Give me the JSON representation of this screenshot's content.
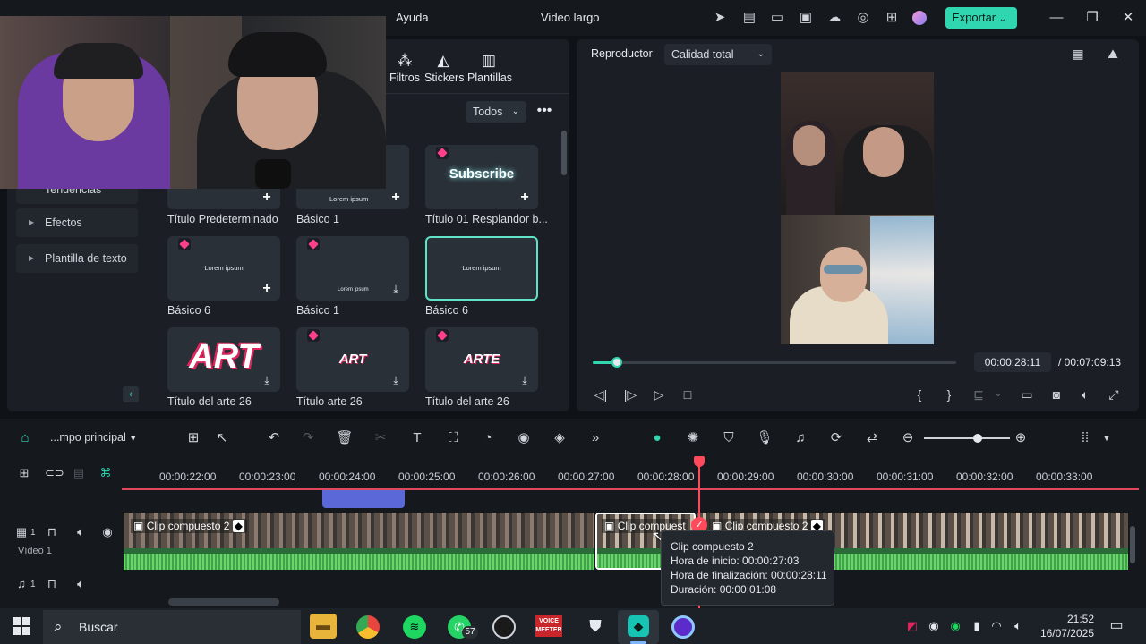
{
  "app": {
    "menu_help": "Ayuda",
    "project_title": "Video largo",
    "export_label": "Exportar",
    "accent": "#2fd6b0"
  },
  "media_tabs": [
    {
      "label": "Filtros",
      "icon": "filters-icon"
    },
    {
      "label": "Stickers",
      "icon": "stickers-icon"
    },
    {
      "label": "Plantillas",
      "icon": "templates-icon"
    }
  ],
  "filter": {
    "selected": "Todos"
  },
  "sidebar": {
    "items": [
      {
        "label": "Tendencias"
      },
      {
        "label": "Efectos"
      },
      {
        "label": "Plantilla de texto"
      }
    ]
  },
  "titles": [
    {
      "label": "Título Predeterminado",
      "thumb_text": "",
      "premium": false,
      "action": "add"
    },
    {
      "label": "Básico 1",
      "thumb_text": "Lorem ipsum",
      "premium": false,
      "action": "add"
    },
    {
      "label": "Título 01 Resplandor b...",
      "thumb_text": "Subscribe",
      "premium": true,
      "action": "add"
    },
    {
      "label": "Básico 6",
      "thumb_text": "Lorem ipsum",
      "premium": true,
      "action": "add"
    },
    {
      "label": "Básico 1",
      "thumb_text": "Lorem ipsum",
      "premium": true,
      "action": "download"
    },
    {
      "label": "Básico 6",
      "thumb_text": "Lorem ipsum",
      "premium": false,
      "action": "none",
      "selected": true
    },
    {
      "label": "Título del arte 26",
      "thumb_text": "ART",
      "premium": false,
      "action": "download"
    },
    {
      "label": "Título arte 26",
      "thumb_text": "ART",
      "premium": true,
      "action": "download"
    },
    {
      "label": "Título del arte 26",
      "thumb_text": "ARTE",
      "premium": true,
      "action": "download"
    }
  ],
  "player": {
    "label": "Reproductor",
    "quality": "Calidad total",
    "current_time": "00:00:28:11",
    "total_time": "/ 00:07:09:13",
    "progress": 0.066
  },
  "timeline": {
    "sequence": "...mpo principal",
    "ruler": [
      "00:00:22:00",
      "00:00:23:00",
      "00:00:24:00",
      "00:00:25:00",
      "00:00:26:00",
      "00:00:27:00",
      "00:00:28:00",
      "00:00:29:00",
      "00:00:30:00",
      "00:00:31:00",
      "00:00:32:00",
      "00:00:33:00"
    ],
    "video_track_label": "Vídeo 1",
    "video_track_num": "1",
    "audio_track_num": "1",
    "clips": [
      {
        "title": "Clip compuesto 2"
      },
      {
        "title": "Clip compuest"
      },
      {
        "title": "Clip compuesto 2"
      }
    ],
    "tooltip": {
      "name": "Clip compuesto 2",
      "start": "Hora de inicio: 00:00:27:03",
      "end": "Hora de finalización: 00:00:28:11",
      "duration": "Duración: 00:00:01:08"
    }
  },
  "taskbar": {
    "search": "Buscar",
    "whatsapp_badge": "57",
    "voicemeeter": "VOICE MEETER",
    "time": "21:52",
    "date": "16/07/2025"
  }
}
